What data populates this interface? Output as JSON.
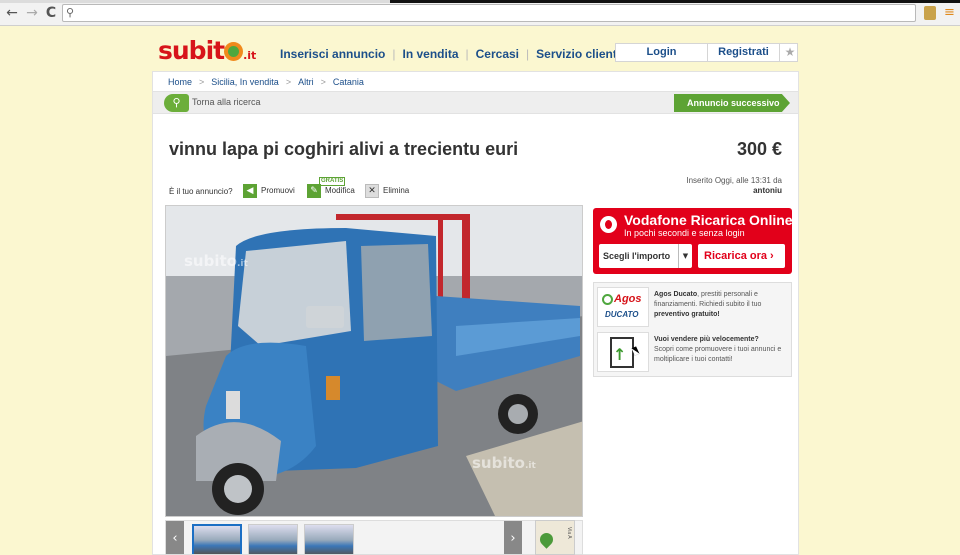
{
  "browser": {
    "back_glyph": "←",
    "forward_glyph": "→",
    "reload_glyph": "C",
    "menu_glyph": "≡",
    "url": ""
  },
  "header": {
    "logo_text": "subit",
    "logo_tld": ".it",
    "nav": [
      "Inserisci annuncio",
      "In vendita",
      "Cercasi",
      "Servizio clienti"
    ],
    "login_label": "Login",
    "register_label": "Registrati"
  },
  "breadcrumb": [
    "Home",
    "Sicilia, In vendita",
    "Altri",
    "Catania"
  ],
  "actionbar": {
    "back_label": "Torna alla ricerca",
    "next_label": "Annuncio successivo"
  },
  "ad": {
    "title": "vinnu lapa pi coghiri alivi a trecientu euri",
    "price": "300 €",
    "your_ad_label": "È il tuo annuncio?",
    "promote_label": "Promuovi",
    "gratis_badge": "GRATIS",
    "edit_label": "Modifica",
    "delete_label": "Elimina",
    "posted_label": "Inserito Oggi, alle 13:31 da",
    "author": "antoniu"
  },
  "gallery": {
    "watermark": "subito",
    "watermark_tld": ".it",
    "prev_glyph": "‹",
    "next_glyph": "›",
    "thumb_count": 3,
    "map_label": "Via A"
  },
  "vodafone": {
    "title": "Vodafone Ricarica Online",
    "subtitle": "In pochi secondi e senza login",
    "select_label": "Scegli l'importo",
    "button_label": "Ricarica ora ›"
  },
  "promos": [
    {
      "logo": "Agos",
      "logo_sub": "DUCATO",
      "title": "Agos Ducato",
      "text": ", prestiti personali e finanziamenti. Richiedi subito il tuo",
      "bold_tail": "preventivo gratuito!"
    },
    {
      "title": "Vuoi vendere più velocemente?",
      "text": "Scopri come promuovere i tuoi annunci e moltiplicare i tuoi contatti!"
    }
  ],
  "colors": {
    "brand_red": "#d7141a",
    "link_blue": "#1c4f8a",
    "action_green": "#5da334",
    "vodafone_red": "#e2001a",
    "page_bg": "#fbf7d0"
  }
}
